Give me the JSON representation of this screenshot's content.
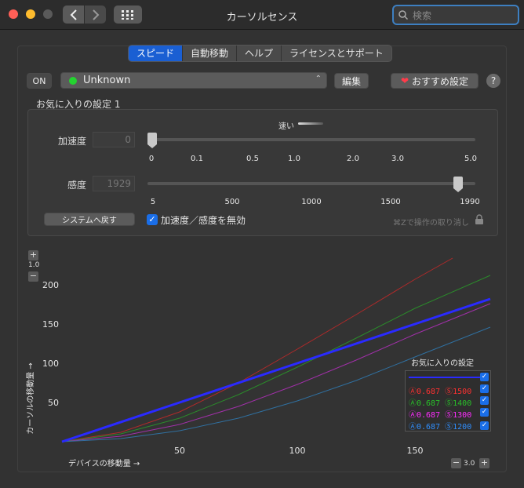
{
  "window": {
    "title": "カーソルセンス",
    "search_placeholder": "検索"
  },
  "tabs": [
    "スピード",
    "自動移動",
    "ヘルプ",
    "ライセンスとサポート"
  ],
  "toolbar": {
    "on_label": "ON",
    "preset_value": "Unknown",
    "edit_label": "編集",
    "recommended_label": "おすすめ設定",
    "help_label": "?"
  },
  "favorites": {
    "section_label": "お気に入りの設定 1",
    "fast_label": "速い",
    "acceleration": {
      "label": "加速度",
      "value": "0",
      "level": 0.0,
      "ticks": [
        "0",
        "0.1",
        "0.5",
        "1.0",
        "2.0",
        "3.0",
        "5.0"
      ]
    },
    "sensitivity": {
      "label": "感度",
      "value": "1929",
      "level": 0.96,
      "ticks": [
        "5",
        "500",
        "1000",
        "1500",
        "1990"
      ]
    },
    "system_reset_label": "システムへ戻す",
    "disable_label": "加速度／感度を無効",
    "undo_label": "⌘Zで操作の取り消し"
  },
  "graph": {
    "zoom_y": "1.0",
    "zoom_x": "3.0",
    "legend_title": "お気に入りの設定",
    "legend": [
      {
        "text": "",
        "color": "#2a2aff"
      },
      {
        "a": "Ⓐ0.687",
        "s": "Ⓢ1500",
        "color": "#ff3030"
      },
      {
        "a": "Ⓐ0.687",
        "s": "Ⓢ1400",
        "color": "#29c029"
      },
      {
        "a": "Ⓐ0.687",
        "s": "Ⓢ1300",
        "color": "#ff2cff"
      },
      {
        "a": "Ⓐ0.687",
        "s": "Ⓢ1200",
        "color": "#2f8fff"
      }
    ]
  },
  "chart_data": {
    "type": "line",
    "xlabel": "デバイスの移動量 →",
    "ylabel": "カーソルの移動量 →",
    "x_ticks": [
      50,
      100,
      150
    ],
    "y_ticks": [
      50,
      100,
      150,
      200
    ],
    "xlim": [
      0,
      182
    ],
    "ylim": [
      0,
      240
    ],
    "grid": false,
    "legend_position": "bottom-right",
    "series": [
      {
        "color": "#2a2aff",
        "x": [
          0,
          50,
          100,
          150,
          182
        ],
        "y": [
          0,
          50,
          100,
          150,
          182
        ]
      },
      {
        "color": "#b02a2a",
        "x": [
          0,
          25,
          50,
          75,
          100,
          125,
          150,
          166
        ],
        "y": [
          0,
          12,
          38,
          75,
          118,
          162,
          207,
          234
        ]
      },
      {
        "color": "#2b8a2b",
        "x": [
          0,
          25,
          50,
          75,
          100,
          125,
          150,
          182
        ],
        "y": [
          0,
          10,
          30,
          60,
          95,
          132,
          170,
          212
        ]
      },
      {
        "color": "#a030a8",
        "x": [
          0,
          25,
          50,
          75,
          100,
          125,
          150,
          182
        ],
        "y": [
          0,
          7,
          22,
          45,
          73,
          104,
          137,
          176
        ]
      },
      {
        "color": "#3070a0",
        "x": [
          0,
          25,
          50,
          75,
          100,
          125,
          150,
          182
        ],
        "y": [
          0,
          4,
          14,
          30,
          52,
          78,
          108,
          146
        ]
      }
    ]
  }
}
